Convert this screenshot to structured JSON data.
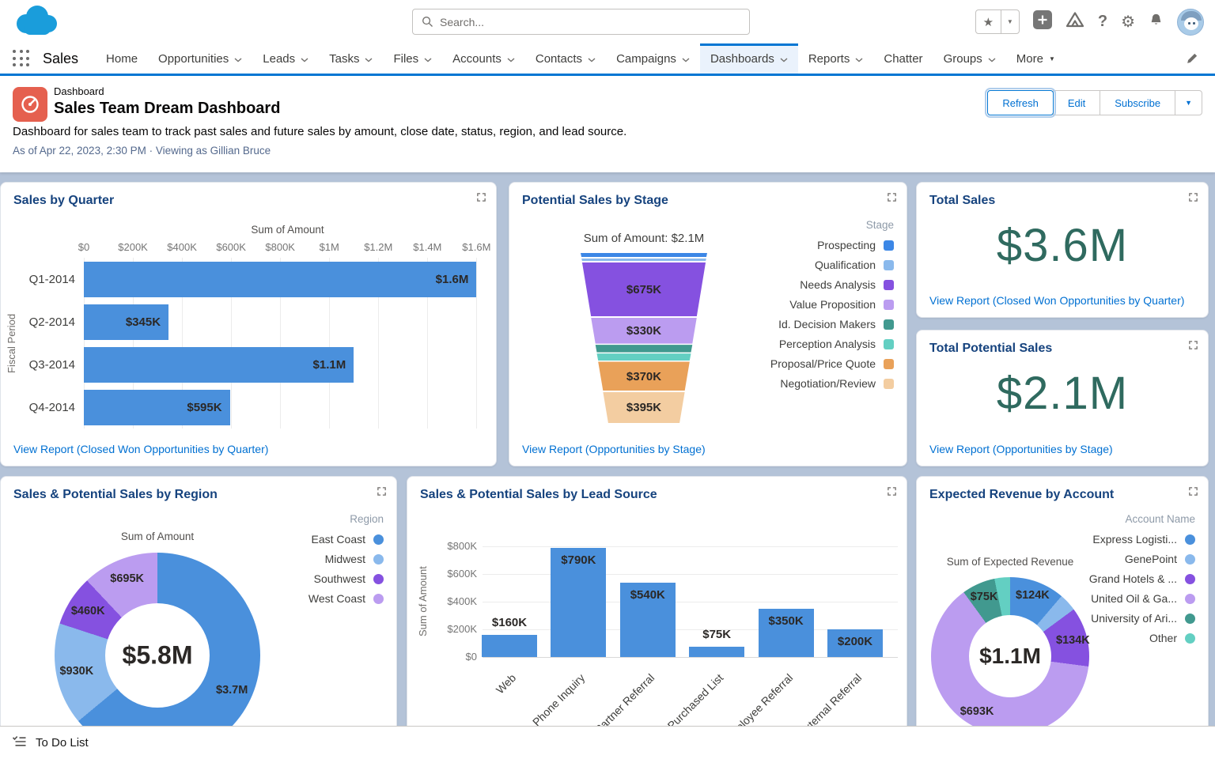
{
  "header": {
    "search_placeholder": "Search...",
    "app_name": "Sales",
    "nav_tabs": [
      {
        "label": "Home",
        "chevron": false,
        "active": false
      },
      {
        "label": "Opportunities",
        "chevron": true,
        "active": false
      },
      {
        "label": "Leads",
        "chevron": true,
        "active": false
      },
      {
        "label": "Tasks",
        "chevron": true,
        "active": false
      },
      {
        "label": "Files",
        "chevron": true,
        "active": false
      },
      {
        "label": "Accounts",
        "chevron": true,
        "active": false
      },
      {
        "label": "Contacts",
        "chevron": true,
        "active": false
      },
      {
        "label": "Campaigns",
        "chevron": true,
        "active": false
      },
      {
        "label": "Dashboards",
        "chevron": true,
        "active": true
      },
      {
        "label": "Reports",
        "chevron": true,
        "active": false
      },
      {
        "label": "Chatter",
        "chevron": false,
        "active": false
      },
      {
        "label": "Groups",
        "chevron": true,
        "active": false
      },
      {
        "label": "More",
        "chevron": "solid",
        "active": false
      }
    ]
  },
  "page": {
    "record_type": "Dashboard",
    "title": "Sales Team Dream Dashboard",
    "description": "Dashboard for sales team to track past sales and future sales by amount, close date, status, region, and lead source.",
    "as_of": "As of Apr 22, 2023, 2:30 PM · Viewing as Gillian Bruce",
    "actions": [
      "Refresh",
      "Edit",
      "Subscribe"
    ]
  },
  "panels": {
    "sales_by_quarter": {
      "title": "Sales by Quarter",
      "link": "View Report (Closed Won Opportunities by Quarter)"
    },
    "potential_by_stage": {
      "title": "Potential Sales by Stage",
      "link": "View Report (Opportunities by Stage)"
    },
    "total_sales": {
      "title": "Total Sales",
      "value": "$3.6M",
      "link": "View Report (Closed Won Opportunities by Quarter)"
    },
    "total_potential_sales": {
      "title": "Total Potential Sales",
      "value": "$2.1M",
      "link": "View Report (Opportunities by Stage)"
    },
    "region": {
      "title": "Sales & Potential Sales by Region"
    },
    "lead_source": {
      "title": "Sales & Potential Sales by Lead Source"
    },
    "expected_revenue": {
      "title": "Expected Revenue by Account"
    }
  },
  "footer": {
    "label": "To Do List"
  },
  "colors": {
    "accent": "#0176d3",
    "link": "#0070d2",
    "metric_green": "#2f6a5f",
    "chart_blue": "#4a90dc",
    "background": "#b4c3d8"
  },
  "chart_data": [
    {
      "key": "sales_by_quarter",
      "type": "bar",
      "orientation": "horizontal",
      "title": "Sum of Amount",
      "ylabel": "Fiscal Period",
      "categories": [
        "Q1-2014",
        "Q2-2014",
        "Q3-2014",
        "Q4-2014"
      ],
      "values": [
        1600000,
        345000,
        1100000,
        595000
      ],
      "labels": [
        "$1.6M",
        "$345K",
        "$1.1M",
        "$595K"
      ],
      "ticks": [
        "$0",
        "$200K",
        "$400K",
        "$600K",
        "$800K",
        "$1M",
        "$1.2M",
        "$1.4M",
        "$1.6M"
      ],
      "tick_step": 200000,
      "axis_max": 1660000,
      "bar_color": "#4a90dc",
      "grid": true
    },
    {
      "key": "potential_by_stage",
      "type": "funnel",
      "title": "Sum of Amount: $2.1M",
      "legend_title": "Stage",
      "legend_position": "right",
      "segments": [
        {
          "name": "Prospecting",
          "value": 65000,
          "label": null,
          "color": "#3c87e6"
        },
        {
          "name": "Qualification",
          "value": 15000,
          "label": null,
          "color": "#8ab9ec"
        },
        {
          "name": "Needs Analysis",
          "value": 675000,
          "label": "$675K",
          "color": "#8551e0"
        },
        {
          "name": "Value Proposition",
          "value": 330000,
          "label": "$330K",
          "color": "#bb9cf0"
        },
        {
          "name": "Id. Decision Makers",
          "value": 105000,
          "label": null,
          "color": "#41998f"
        },
        {
          "name": "Perception Analysis",
          "value": 100000,
          "label": null,
          "color": "#63cfc2"
        },
        {
          "name": "Proposal/Price Quote",
          "value": 370000,
          "label": "$370K",
          "color": "#e9a159"
        },
        {
          "name": "Negotiation/Review",
          "value": 395000,
          "label": "$395K",
          "color": "#f3cda1"
        }
      ]
    },
    {
      "key": "region",
      "type": "pie",
      "title": "Sum of Amount",
      "center_label": "$5.8M",
      "legend_title": "Region",
      "legend_position": "right",
      "slices": [
        {
          "name": "East Coast",
          "value": 3700000,
          "label": "$3.7M",
          "color": "#4a90dc"
        },
        {
          "name": "Midwest",
          "value": 930000,
          "label": "$930K",
          "color": "#8ab9ec"
        },
        {
          "name": "Southwest",
          "value": 460000,
          "label": "$460K",
          "color": "#8551e0"
        },
        {
          "name": "West Coast",
          "value": 695000,
          "label": "$695K",
          "color": "#bb9cf0"
        }
      ]
    },
    {
      "key": "lead_source",
      "type": "bar",
      "orientation": "vertical",
      "ylabel": "Sum of Amount",
      "categories": [
        "Web",
        "Phone Inquiry",
        "Partner Referral",
        "Purchased List",
        "Employee Referral",
        "External Referral"
      ],
      "values": [
        160000,
        790000,
        540000,
        75000,
        350000,
        200000
      ],
      "labels": [
        "$160K",
        "$790K",
        "$540K",
        "$75K",
        "$350K",
        "$200K"
      ],
      "ticks": [
        "$0",
        "$200K",
        "$400K",
        "$600K",
        "$800K"
      ],
      "tick_step": 200000,
      "axis_max": 800000,
      "bar_color": "#4a90dc",
      "grid": true
    },
    {
      "key": "expected_revenue",
      "type": "pie",
      "title": "Sum of Expected Revenue",
      "center_label": "$1.1M",
      "legend_title": "Account Name",
      "legend_position": "right",
      "slices": [
        {
          "name": "Express Logisti...",
          "value": 124000,
          "label": "$124K",
          "color": "#4a90dc"
        },
        {
          "name": "GenePoint",
          "value": 40000,
          "label": null,
          "color": "#8ab9ec"
        },
        {
          "name": "Grand Hotels & ...",
          "value": 134000,
          "label": "$134K",
          "color": "#8551e0"
        },
        {
          "name": "United Oil & Ga...",
          "value": 693000,
          "label": "$693K",
          "color": "#bb9cf0"
        },
        {
          "name": "University of Ari...",
          "value": 75000,
          "label": "$75K",
          "color": "#41998f"
        },
        {
          "name": "Other",
          "value": 35000,
          "label": null,
          "color": "#63cfc2"
        }
      ]
    }
  ]
}
